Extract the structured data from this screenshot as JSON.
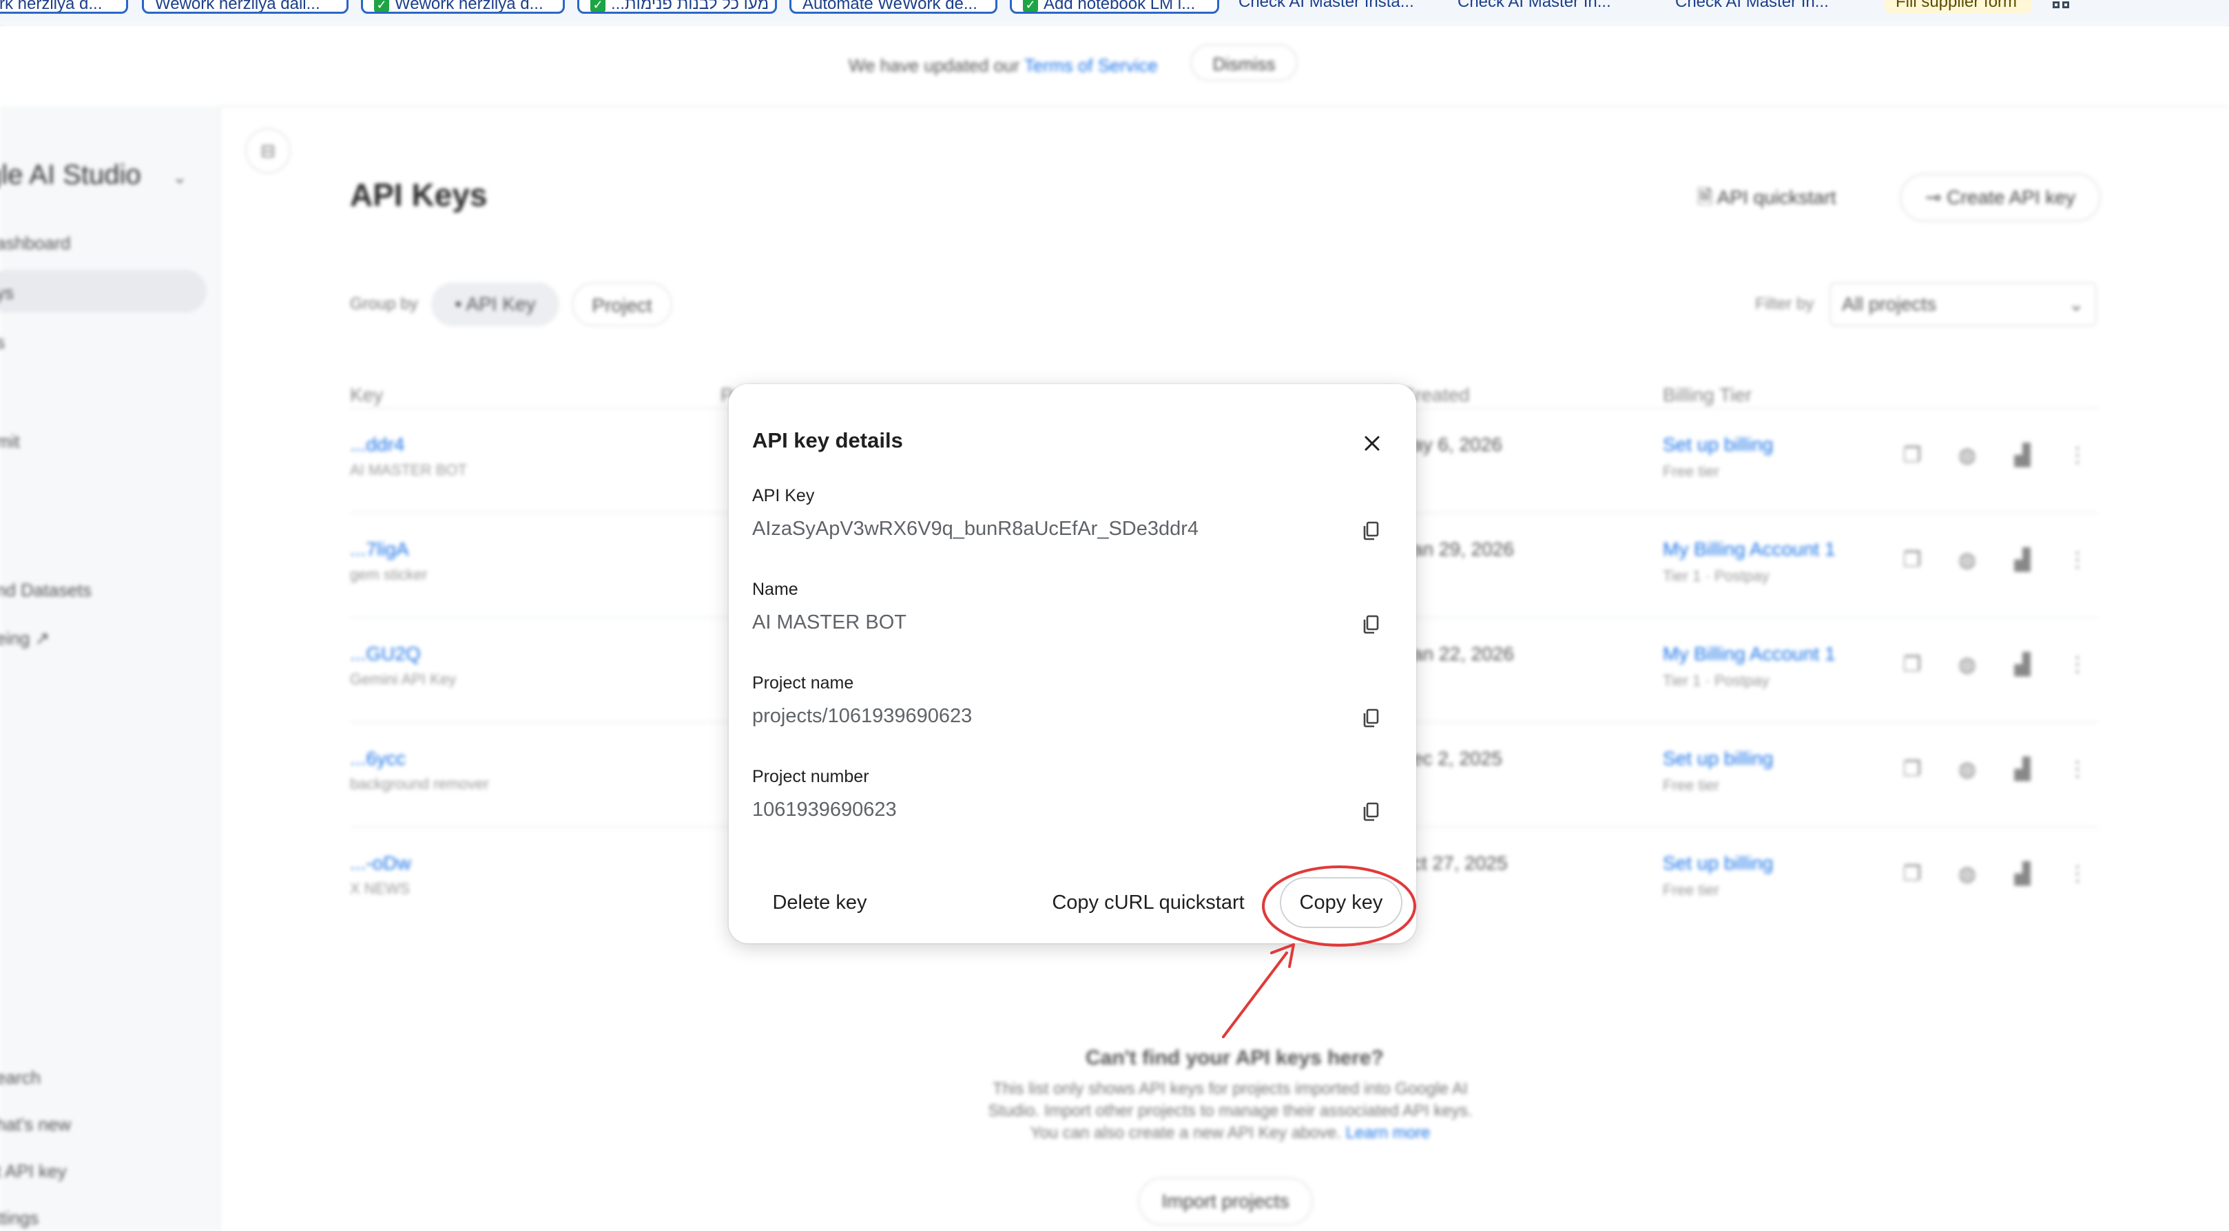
{
  "bookmarks": [
    {
      "label": "rk herzliya d..."
    },
    {
      "label": "Wework herzliya dail..."
    },
    {
      "label": "Wework herzliya d..."
    },
    {
      "label": "...מעו כל לבנות פנימות"
    },
    {
      "label": "Automate WeWork de..."
    },
    {
      "label": "Add notebook LM l..."
    },
    {
      "label": "Check AI Master Insta..."
    },
    {
      "label": "Check AI Master In..."
    },
    {
      "label": "Check AI Master In..."
    },
    {
      "label": "Fill supplier form"
    }
  ],
  "banner": {
    "text": "We have updated our",
    "link": "Terms of Service",
    "dismiss": "Dismiss"
  },
  "sidebar": {
    "title": "gle AI Studio",
    "items": [
      {
        "label": "ashboard"
      },
      {
        "label": "ys"
      },
      {
        "label": "s"
      },
      {
        "label": ""
      },
      {
        "label": "mit"
      },
      {
        "label": ""
      },
      {
        "label": "nd Datasets"
      },
      {
        "label": "eing"
      },
      {
        "label": "earch"
      },
      {
        "label": "hat's new"
      },
      {
        "label": "t API key"
      },
      {
        "label": "ttings"
      }
    ]
  },
  "page": {
    "title": "API Keys",
    "quickstart": "API quickstart",
    "create_key": "Create API key",
    "group_by_label": "Group by",
    "group_options": [
      "API Key",
      "Project"
    ],
    "filter_label": "Filter by",
    "filter_value": "All projects",
    "columns": [
      "Key",
      "Project",
      "Created",
      "Billing Tier"
    ],
    "rows": [
      {
        "key": "...ddr4",
        "name": "AI MASTER BOT",
        "created": "ay 6, 2026",
        "billing": "Set up billing",
        "tier": "Free tier"
      },
      {
        "key": "...7ligA",
        "name": "gem sticker",
        "created": "an 29, 2026",
        "billing": "My Billing Account 1",
        "tier": "Tier 1 · Postpay"
      },
      {
        "key": "...GU2Q",
        "name": "Gemini API Key",
        "created": "an 22, 2026",
        "billing": "My Billing Account 1",
        "tier": "Tier 1 · Postpay"
      },
      {
        "key": "...6ycc",
        "name": "background remover",
        "created": "ec 2, 2025",
        "billing": "Set up billing",
        "tier": "Free tier"
      },
      {
        "key": "...-oDw",
        "name": "X NEWS",
        "created": "ct 27, 2025",
        "billing": "Set up billing",
        "tier": "Free tier"
      }
    ],
    "empty_title": "Can't find your API keys here?",
    "empty_lines": [
      "This list only shows API keys for projects imported into Google AI",
      "Studio. Import other projects to manage their associated API keys.",
      "You can also create a new API Key above."
    ],
    "empty_link": "Learn more",
    "import_button": "Import projects"
  },
  "dialog": {
    "title": "API key details",
    "fields": [
      {
        "label": "API Key",
        "value": "AIzaSyApV3wRX6V9q_bunR8aUcEfAr_SDe3ddr4"
      },
      {
        "label": "Name",
        "value": "AI MASTER BOT"
      },
      {
        "label": "Project name",
        "value": "projects/1061939690623"
      },
      {
        "label": "Project number",
        "value": "1061939690623"
      }
    ],
    "delete_label": "Delete key",
    "curl_label": "Copy cURL quickstart",
    "copy_key_label": "Copy key"
  },
  "colors": {
    "accent": "#1a73e8",
    "annotation": "#e03a3a"
  }
}
